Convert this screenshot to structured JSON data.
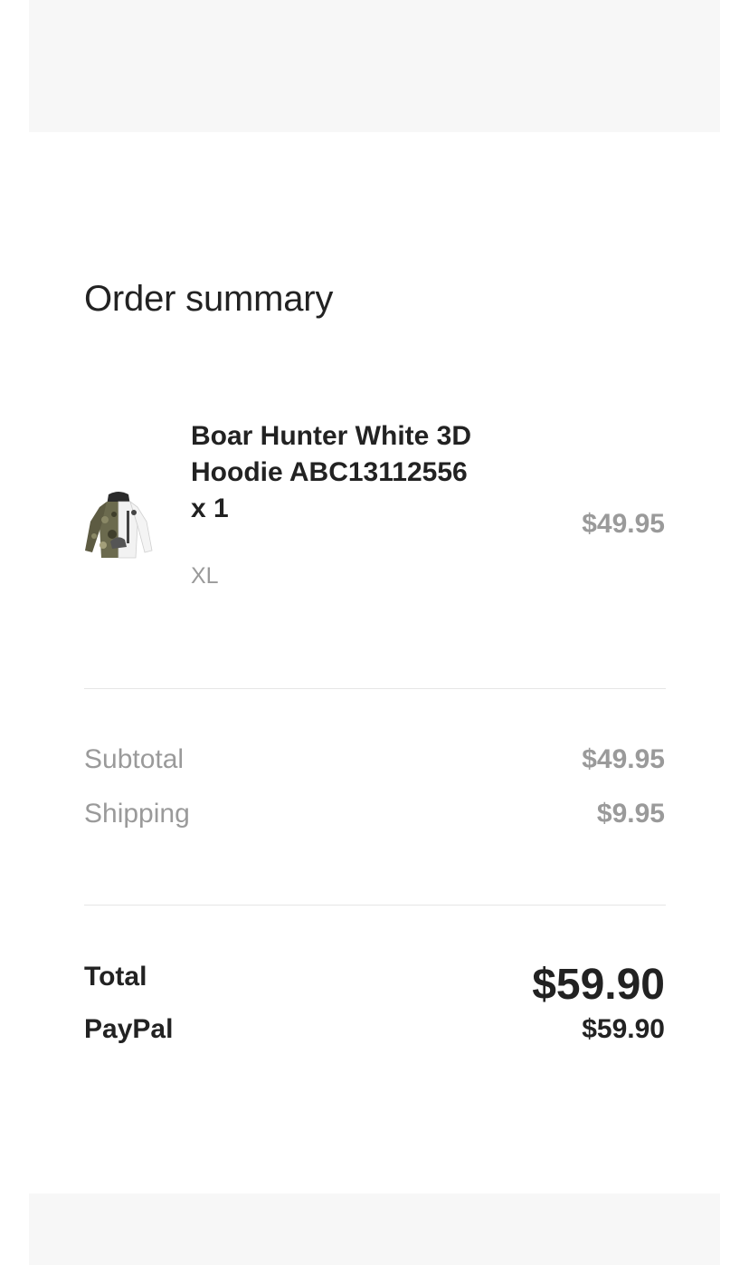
{
  "order_summary": {
    "title": "Order summary",
    "item": {
      "name": "Boar Hunter White 3D Hoodie ABC13112556 x 1",
      "variant": "XL",
      "price": "$49.95",
      "thumbnail_icon": "hoodie-thumbnail"
    },
    "subtotal": {
      "label": "Subtotal",
      "value": "$49.95"
    },
    "shipping": {
      "label": "Shipping",
      "value": "$9.95"
    },
    "total": {
      "label": "Total",
      "value": "$59.90"
    },
    "payment": {
      "label": "PayPal",
      "value": "$59.90"
    }
  },
  "colors": {
    "panel": "#f7f7f7",
    "text_primary": "#222222",
    "text_muted": "#9a9a9a",
    "divider": "#e6e6e6"
  }
}
